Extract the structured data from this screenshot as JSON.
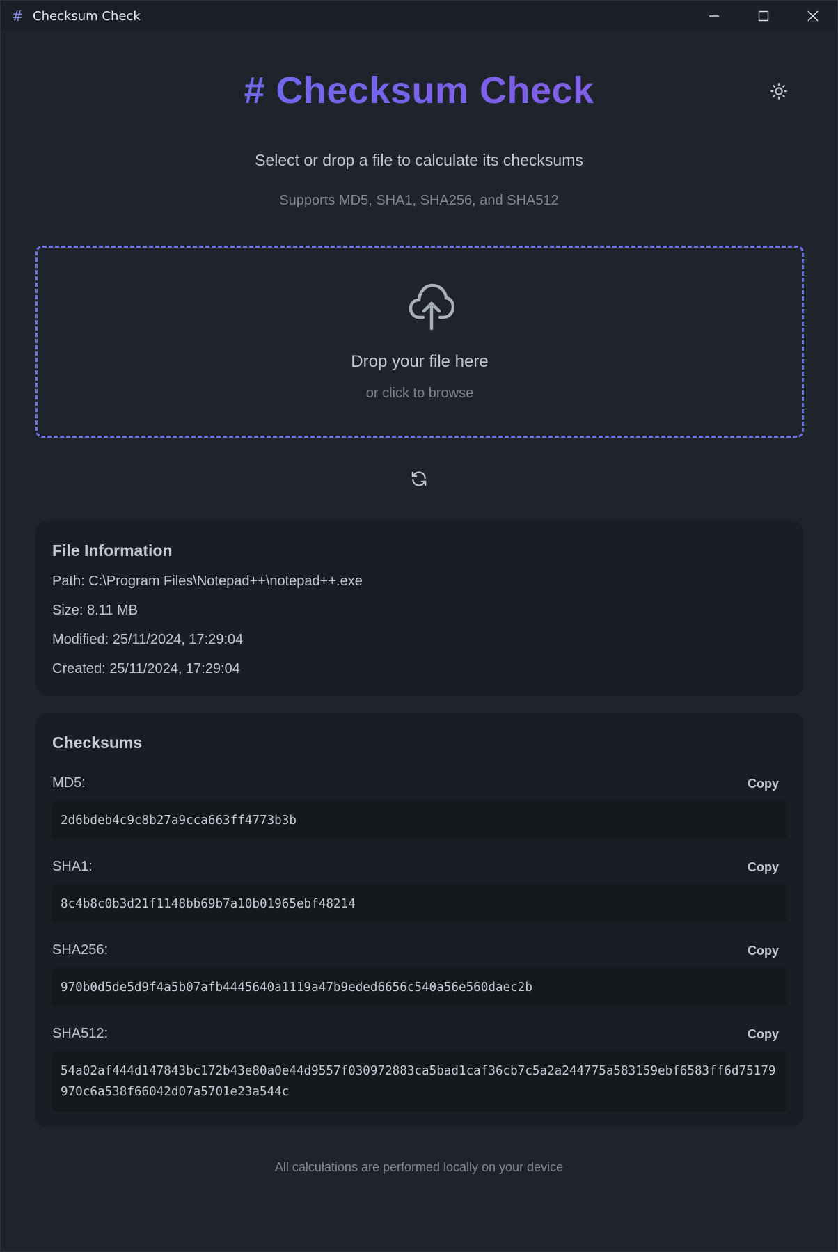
{
  "window": {
    "title": "Checksum Check",
    "icon": "hash-icon",
    "controls": [
      "minimize-icon",
      "maximize-icon",
      "close-icon"
    ]
  },
  "header": {
    "title": "# Checksum Check",
    "theme_icon": "sun-icon"
  },
  "intro": {
    "subtitle": "Select or drop a file to calculate its checksums",
    "support": "Supports MD5, SHA1, SHA256, and SHA512"
  },
  "dropzone": {
    "icon": "cloud-upload-icon",
    "main": "Drop your file here",
    "sub": "or click to browse"
  },
  "refresh_icon": "refresh-icon",
  "file_info": {
    "heading": "File Information",
    "path": "Path: C:\\Program Files\\Notepad++\\notepad++.exe",
    "size": "Size: 8.11 MB",
    "modified": "Modified: 25/11/2024, 17:29:04",
    "created": "Created: 25/11/2024, 17:29:04"
  },
  "checksums": {
    "heading": "Checksums",
    "copy_label": "Copy",
    "items": [
      {
        "label": "MD5:",
        "value": "2d6bdeb4c9c8b27a9cca663ff4773b3b"
      },
      {
        "label": "SHA1:",
        "value": "8c4b8c0b3d21f1148bb69b7a10b01965ebf48214"
      },
      {
        "label": "SHA256:",
        "value": "970b0d5de5d9f4a5b07afb4445640a1119a47b9eded6656c540a56e560daec2b"
      },
      {
        "label": "SHA512:",
        "value": "54a02af444d147843bc172b43e80a0e44d9557f030972883ca5bad1caf36cb7c5a2a244775a583159ebf6583ff6d75179970c6a538f66042d07a5701e23a544c"
      }
    ]
  },
  "footer": "All calculations are performed locally on your device",
  "colors": {
    "background": "#1f232c",
    "accent": "#6b73e6",
    "title_gradient_start": "#6372f0",
    "title_gradient_end": "#8b5ce6",
    "card": "#1a1d23"
  }
}
